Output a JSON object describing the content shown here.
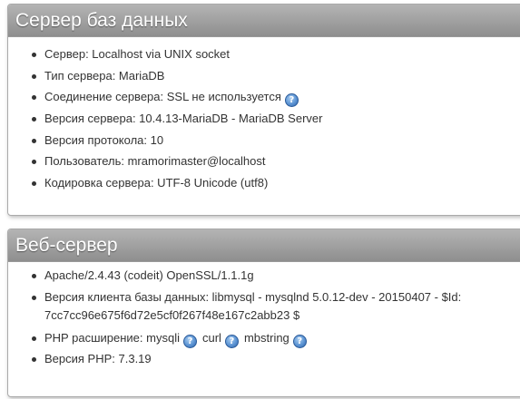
{
  "db_server": {
    "title": "Сервер баз данных",
    "items": [
      "Сервер: Localhost via UNIX socket",
      "Тип сервера: MariaDB",
      "Соединение сервера: SSL не используется",
      "Версия сервера: 10.4.13-MariaDB - MariaDB Server",
      "Версия протокола: 10",
      "Пользователь: mramorimaster@localhost",
      "Кодировка сервера: UTF-8 Unicode (utf8)"
    ]
  },
  "web_server": {
    "title": "Веб-сервер",
    "apache": "Apache/2.4.43 (codeit) OpenSSL/1.1.1g",
    "db_client_line1": "Версия клиента базы данных: libmysql - mysqlnd 5.0.12-dev - 20150407 - $Id:",
    "db_client_line2": "7cc7cc96e675f6d72e5cf0f267f48e167c2abb23 $",
    "php_ext_label": "PHP расширение:",
    "php_ext": [
      "mysqli",
      "curl",
      "mbstring"
    ],
    "php_version": "Версия PHP: 7.3.19"
  },
  "icons": {
    "help": "help-icon",
    "help_glyph": "?"
  },
  "colors": {
    "header_bg": "#9e9e9e",
    "header_text": "#ffffff",
    "body_text": "#333333",
    "help_icon": "#4a86c8"
  }
}
